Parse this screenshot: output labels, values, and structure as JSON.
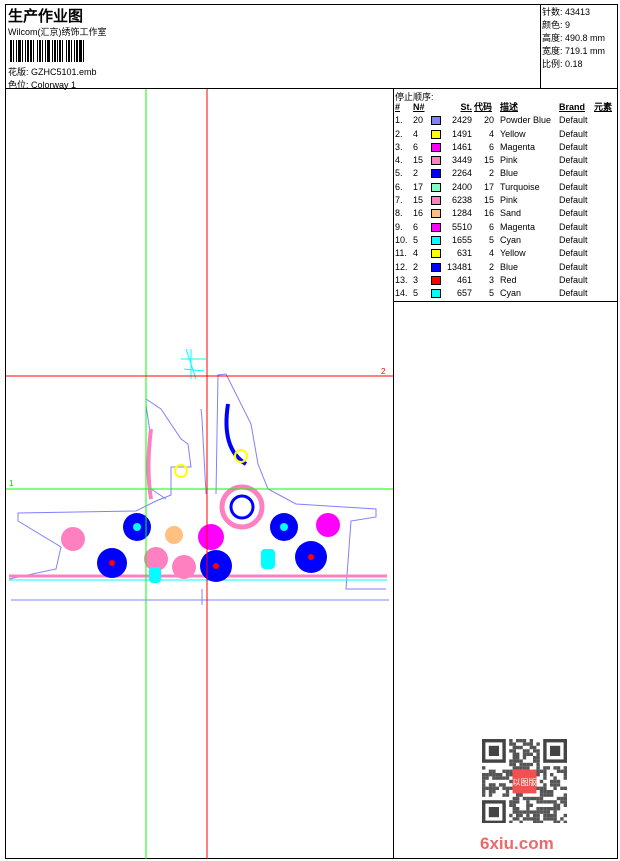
{
  "header": {
    "title": "生产作业图",
    "company": "Wilcom(汇京)绣饰工作室",
    "design_label": "花版:",
    "design_value": "GZHC5101.emb",
    "colorway_label": "色位:",
    "colorway_value": "Colorway 1"
  },
  "stats": [
    {
      "label": "针数:",
      "value": "43413"
    },
    {
      "label": "颜色:",
      "value": "9"
    },
    {
      "label": "高度:",
      "value": "490.8 mm"
    },
    {
      "label": "宽度:",
      "value": "719.1 mm"
    },
    {
      "label": "比例:",
      "value": "0.18"
    }
  ],
  "stop_sequence": {
    "heading": "停止顺序:",
    "columns": [
      "#",
      "N#",
      "St.",
      "代码",
      "描述",
      "Brand",
      "元素"
    ],
    "rows": [
      {
        "n": "1.",
        "needle": "20",
        "color": "#8080ff",
        "st": "2429",
        "code": "20",
        "desc": "Powder Blue",
        "brand": "Default"
      },
      {
        "n": "2.",
        "needle": "4",
        "color": "#ffff00",
        "st": "1491",
        "code": "4",
        "desc": "Yellow",
        "brand": "Default"
      },
      {
        "n": "3.",
        "needle": "6",
        "color": "#ff00ff",
        "st": "1461",
        "code": "6",
        "desc": "Magenta",
        "brand": "Default"
      },
      {
        "n": "4.",
        "needle": "15",
        "color": "#ff80c0",
        "st": "3449",
        "code": "15",
        "desc": "Pink",
        "brand": "Default"
      },
      {
        "n": "5.",
        "needle": "2",
        "color": "#0000ff",
        "st": "2264",
        "code": "2",
        "desc": "Blue",
        "brand": "Default"
      },
      {
        "n": "6.",
        "needle": "17",
        "color": "#80ffc0",
        "st": "2400",
        "code": "17",
        "desc": "Turquoise",
        "brand": "Default"
      },
      {
        "n": "7.",
        "needle": "15",
        "color": "#ff80c0",
        "st": "6238",
        "code": "15",
        "desc": "Pink",
        "brand": "Default"
      },
      {
        "n": "8.",
        "needle": "16",
        "color": "#ffc080",
        "st": "1284",
        "code": "16",
        "desc": "Sand",
        "brand": "Default"
      },
      {
        "n": "9.",
        "needle": "6",
        "color": "#ff00ff",
        "st": "5510",
        "code": "6",
        "desc": "Magenta",
        "brand": "Default"
      },
      {
        "n": "10.",
        "needle": "5",
        "color": "#00ffff",
        "st": "1655",
        "code": "5",
        "desc": "Cyan",
        "brand": "Default"
      },
      {
        "n": "11.",
        "needle": "4",
        "color": "#ffff00",
        "st": "631",
        "code": "4",
        "desc": "Yellow",
        "brand": "Default"
      },
      {
        "n": "12.",
        "needle": "2",
        "color": "#0000ff",
        "st": "13481",
        "code": "2",
        "desc": "Blue",
        "brand": "Default"
      },
      {
        "n": "13.",
        "needle": "3",
        "color": "#ff0000",
        "st": "461",
        "code": "3",
        "desc": "Red",
        "brand": "Default"
      },
      {
        "n": "14.",
        "needle": "5",
        "color": "#00ffff",
        "st": "657",
        "code": "5",
        "desc": "Cyan",
        "brand": "Default"
      }
    ]
  },
  "canvas": {
    "guide1_label": "1",
    "guide2_label": "2"
  },
  "watermark": "6xiu.com",
  "qr_seal": "以图版"
}
